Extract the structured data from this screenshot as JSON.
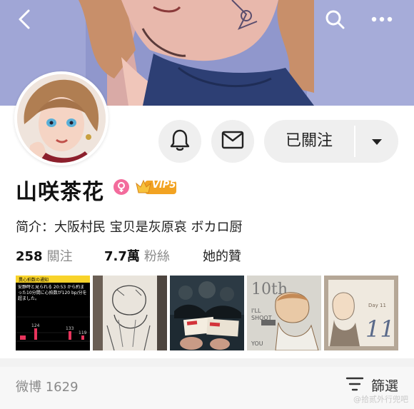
{
  "header": {
    "back_icon": "chevron-left-icon",
    "search_icon": "search-icon",
    "more_icon": "more-horizontal-icon"
  },
  "profile": {
    "name": "山咲茶花",
    "gender_icon": "female-icon",
    "gender_color": "#f36b9c",
    "vip_label": "VIP5",
    "bio": "简介：大阪村民 宝贝是灰原哀 ボカロ厨",
    "follow_button": "已關注",
    "dropdown_icon": "caret-down-icon",
    "bell_icon": "bell-icon",
    "message_icon": "mail-icon"
  },
  "stats": [
    {
      "value": "258",
      "label": "關注"
    },
    {
      "value": "7.7萬",
      "label": "粉絲"
    },
    {
      "value": "",
      "label": "她的贊"
    }
  ],
  "thumbnails": [
    {
      "kind": "screenshot",
      "texts": [
        "異心拍数の通知",
        "安静時と見られる 20:53 から約まった10分間に心拍数が120 bp/分を超ました。",
        "124",
        "133",
        "119"
      ]
    },
    {
      "kind": "manga-sketch"
    },
    {
      "kind": "ticket-photo"
    },
    {
      "kind": "illustration",
      "texts": [
        "10th",
        "I'LL",
        "SHOOT",
        "YOU"
      ]
    },
    {
      "kind": "illustration",
      "texts": [
        "Day 11",
        "11"
      ]
    }
  ],
  "footer": {
    "weibo_label": "微博 1629",
    "filter_label": "篩選",
    "filter_icon": "filter-icon",
    "watermark": "@拾贰外行兜吧"
  },
  "colors": {
    "banner": "#8f95c9",
    "button_bg": "#efefef",
    "footer_bg": "#f7f7f7"
  }
}
